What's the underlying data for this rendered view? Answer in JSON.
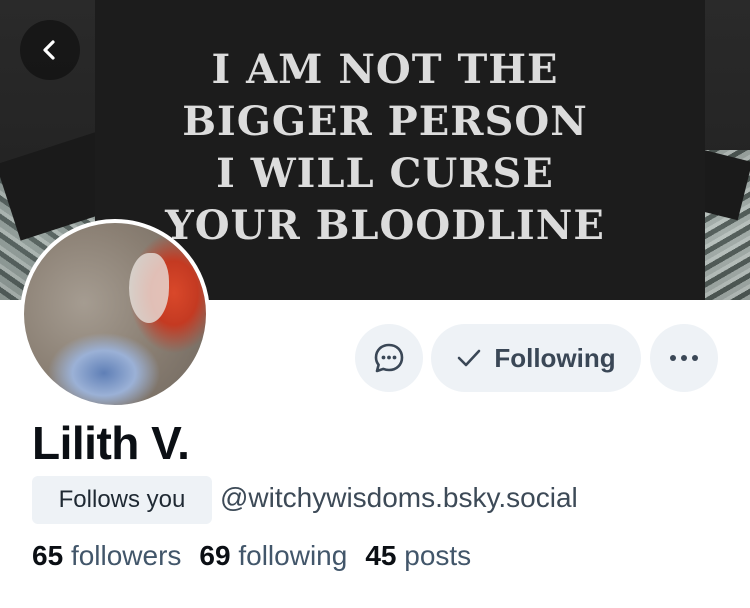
{
  "banner": {
    "shirt_text": [
      "I AM NOT THE",
      "BIGGER PERSON",
      "I WILL CURSE",
      "YOUR BLOODLINE"
    ]
  },
  "profile": {
    "display_name": "Lilith V.",
    "follows_you_badge": "Follows you",
    "handle": "@witchywisdoms.bsky.social"
  },
  "actions": {
    "following_label": "Following",
    "message_icon": "chat-bubble-icon",
    "more_icon": "ellipsis-icon",
    "back_icon": "chevron-left-icon"
  },
  "stats": {
    "followers_count": "65",
    "followers_label": "followers",
    "following_count": "69",
    "following_label": "following",
    "posts_count": "45",
    "posts_label": "posts"
  },
  "colors": {
    "pill_background": "#eef2f6",
    "secondary_text": "#42566a",
    "primary_text": "#0b0f14"
  }
}
